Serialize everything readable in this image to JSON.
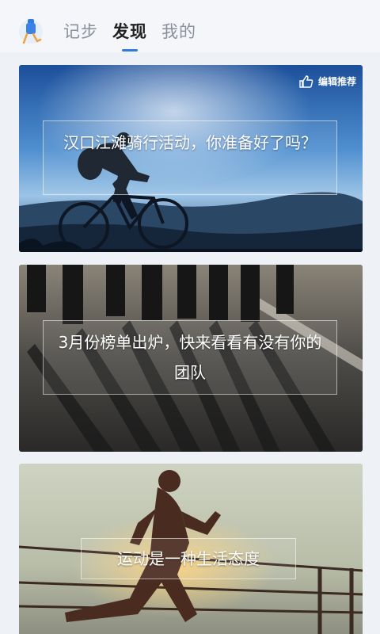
{
  "nav": {
    "tabs": [
      {
        "label": "记步",
        "active": false
      },
      {
        "label": "发现",
        "active": true
      },
      {
        "label": "我的",
        "active": false
      }
    ],
    "accent_color": "#2f7be0"
  },
  "cards": [
    {
      "badge_icon": "thumbs-up-icon",
      "badge": "编辑推荐",
      "caption": "汉口江滩骑行活动，你准备好了吗？"
    },
    {
      "caption": "3月份榜单出炉，快来看看有没有你的团队"
    },
    {
      "caption": "运动是一种生活态度"
    }
  ]
}
